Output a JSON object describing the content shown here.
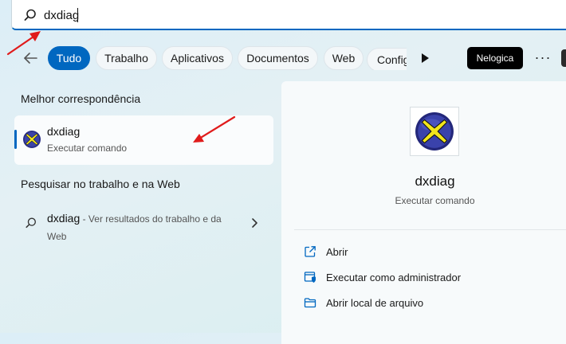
{
  "search": {
    "query": "dxdiag",
    "icon": "search-icon"
  },
  "filters": {
    "back_icon": "arrow-left-icon",
    "chips": [
      {
        "label": "Tudo",
        "active": true
      },
      {
        "label": "Trabalho",
        "active": false
      },
      {
        "label": "Aplicativos",
        "active": false
      },
      {
        "label": "Documentos",
        "active": false
      },
      {
        "label": "Web",
        "active": false
      },
      {
        "label": "Configurações",
        "active": false
      }
    ],
    "badge": "Nelogica",
    "more": "···"
  },
  "best_match": {
    "heading": "Melhor correspondência",
    "name": "dxdiag",
    "subtitle": "Executar comando"
  },
  "web_search": {
    "heading": "Pesquisar no trabalho e na Web",
    "query": "dxdiag",
    "hint": " - Ver resultados do trabalho e da Web"
  },
  "detail": {
    "title": "dxdiag",
    "subtitle": "Executar comando",
    "actions": [
      {
        "label": "Abrir",
        "icon": "open-external-icon"
      },
      {
        "label": "Executar como administrador",
        "icon": "shield-admin-icon"
      },
      {
        "label": "Abrir local de arquivo",
        "icon": "folder-icon"
      }
    ]
  },
  "colors": {
    "accent": "#0067c0",
    "annotation": "#e01b1b",
    "dx_yellow": "#f2e51c",
    "dx_blue": "#2a2f86"
  }
}
